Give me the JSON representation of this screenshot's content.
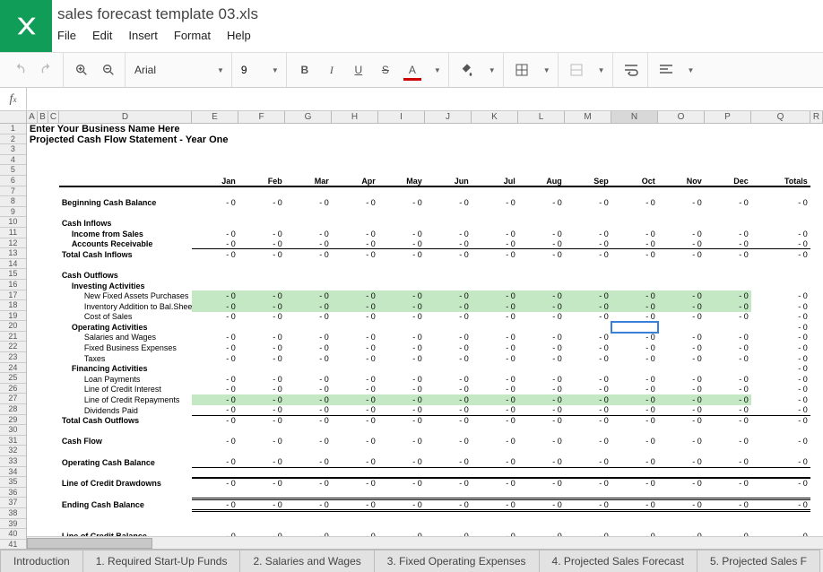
{
  "app": {
    "doc_title": "sales forecast template 03.xls"
  },
  "menu": {
    "file": "File",
    "edit": "Edit",
    "insert": "Insert",
    "format": "Format",
    "help": "Help"
  },
  "toolbar": {
    "font": "Arial",
    "size": "9"
  },
  "formula": {
    "value": ""
  },
  "columns": {
    "letters": [
      "A",
      "B",
      "C",
      "D",
      "E",
      "F",
      "G",
      "H",
      "I",
      "J",
      "K",
      "L",
      "M",
      "N",
      "O",
      "P",
      "Q",
      "R"
    ],
    "widths": [
      12,
      12,
      12,
      148,
      52,
      52,
      52,
      52,
      52,
      52,
      52,
      52,
      52,
      52,
      52,
      52,
      66,
      14
    ],
    "selected": "N"
  },
  "selected_cell": {
    "row": 20,
    "col": "N"
  },
  "row_count": 41,
  "title_rows": {
    "r1": "Enter Your Business Name Here",
    "r2": "Projected Cash Flow Statement - Year One"
  },
  "months": [
    "Jan",
    "Feb",
    "Mar",
    "Apr",
    "May",
    "Jun",
    "Jul",
    "Aug",
    "Sep",
    "Oct",
    "Nov",
    "Dec",
    "Totals"
  ],
  "rows": [
    {
      "r": 8,
      "label": "Beginning Cash Balance",
      "bold": true,
      "values": 12,
      "total": true
    },
    {
      "r": 10,
      "label": "Cash Inflows",
      "bold": true
    },
    {
      "r": 11,
      "label": "Income from Sales",
      "indent": 1,
      "bold": true,
      "values": 12,
      "total": true
    },
    {
      "r": 12,
      "label": "Accounts Receivable",
      "indent": 1,
      "bold": true,
      "values": 12,
      "total": true,
      "underline": true
    },
    {
      "r": 13,
      "label": "Total Cash Inflows",
      "bold": true,
      "values": 12,
      "total": true,
      "topline": true
    },
    {
      "r": 15,
      "label": "Cash Outflows",
      "bold": true
    },
    {
      "r": 16,
      "label": "Investing Activities",
      "indent": 1,
      "bold": true
    },
    {
      "r": 17,
      "label": "New Fixed Assets Purchases",
      "indent": 2,
      "values": 12,
      "total": true,
      "green": true
    },
    {
      "r": 18,
      "label": "Inventory Addition to Bal.Sheet",
      "indent": 2,
      "values": 12,
      "total": true,
      "green": true
    },
    {
      "r": 19,
      "label": "Cost of Sales",
      "indent": 2,
      "values": 12,
      "total": true
    },
    {
      "r": 20,
      "label": "Operating Activities",
      "indent": 1,
      "bold": true,
      "total": true
    },
    {
      "r": 21,
      "label": "Salaries and Wages",
      "indent": 2,
      "values": 12,
      "total": true
    },
    {
      "r": 22,
      "label": "Fixed Business Expenses",
      "indent": 2,
      "values": 12,
      "total": true
    },
    {
      "r": 23,
      "label": "Taxes",
      "indent": 2,
      "values": 12,
      "total": true
    },
    {
      "r": 24,
      "label": "Financing Activities",
      "indent": 1,
      "bold": true,
      "total": true
    },
    {
      "r": 25,
      "label": "Loan Payments",
      "indent": 2,
      "values": 12,
      "total": true
    },
    {
      "r": 26,
      "label": "Line of Credit Interest",
      "indent": 2,
      "values": 12,
      "total": true
    },
    {
      "r": 27,
      "label": "Line of Credit Repayments",
      "indent": 2,
      "values": 12,
      "total": true,
      "green": true
    },
    {
      "r": 28,
      "label": "Dividends Paid",
      "indent": 2,
      "values": 12,
      "total": true,
      "underline": true
    },
    {
      "r": 29,
      "label": "Total Cash Outflows",
      "bold": true,
      "values": 12,
      "total": true,
      "topline": true
    },
    {
      "r": 31,
      "label": "Cash Flow",
      "bold": true,
      "values": 12,
      "total": true
    },
    {
      "r": 33,
      "label": "Operating Cash Balance",
      "bold": true,
      "values": 12,
      "total": true,
      "underline": true
    },
    {
      "r": 35,
      "label": "Line of Credit Drawdowns",
      "bold": true,
      "values": 12,
      "total": true,
      "thicktop": true
    },
    {
      "r": 37,
      "label": "Ending Cash Balance",
      "bold": true,
      "values": 12,
      "total": true,
      "dbltop": true,
      "dblunder": true
    },
    {
      "r": 40,
      "label": "Line of Credit Balance",
      "bold": true,
      "values": 12,
      "total": true
    }
  ],
  "cell_value": "-   0",
  "tabs": [
    "Introduction",
    "1. Required Start-Up Funds",
    "2. Salaries and Wages",
    "3. Fixed Operating Expenses",
    "4. Projected Sales Forecast",
    "5. Projected Sales F"
  ]
}
